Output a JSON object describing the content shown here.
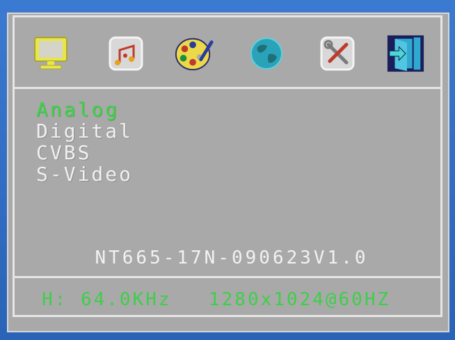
{
  "colors": {
    "background": "#2f6fc4",
    "panel": "#a9a9a9",
    "selected_text": "#3fd14a",
    "normal_text": "#f0f0f0",
    "status_text": "#3ecf48"
  },
  "toolbar": {
    "icons": [
      {
        "name": "monitor-icon"
      },
      {
        "name": "audio-icon"
      },
      {
        "name": "palette-icon"
      },
      {
        "name": "globe-icon"
      },
      {
        "name": "tools-icon"
      },
      {
        "name": "exit-icon",
        "selected": true
      }
    ]
  },
  "menu": {
    "items": [
      {
        "label": "Analog",
        "selected": true
      },
      {
        "label": "Digital",
        "selected": false
      },
      {
        "label": "CVBS",
        "selected": false
      },
      {
        "label": "S-Video",
        "selected": false
      }
    ]
  },
  "version": "NT665-17N-090623V1.0",
  "status": {
    "frequency": "H: 64.0KHz",
    "resolution": "1280x1024@60HZ"
  }
}
